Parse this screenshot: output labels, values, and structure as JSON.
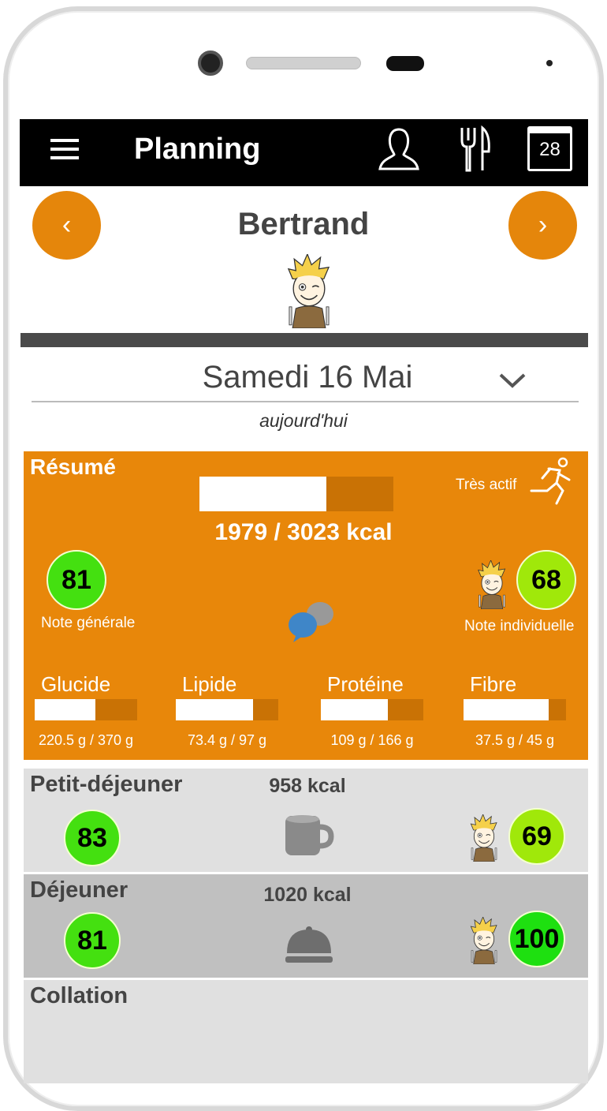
{
  "app_bar": {
    "title": "Planning",
    "icons": [
      "menu-icon",
      "user-icon",
      "fork-knife-icon",
      "calendar-icon"
    ],
    "calendar_day": "28"
  },
  "profile": {
    "name": "Bertrand",
    "prev_icon": "chevron-left",
    "next_icon": "chevron-right"
  },
  "date": {
    "label": "Samedi 16 Mai",
    "sub": "aujourd'hui"
  },
  "summary": {
    "title": "Résumé",
    "activity": "Très actif",
    "kcal_text": "1979 / 3023 kcal",
    "kcal_progress": 0.655,
    "general_score": "81",
    "general_label": "Note générale",
    "individual_score": "68",
    "individual_label": "Note individuelle",
    "macros": [
      {
        "label": "Glucide",
        "value": "220.5 g / 370 g",
        "progress": 0.596
      },
      {
        "label": "Lipide",
        "value": "73.4 g / 97 g",
        "progress": 0.757
      },
      {
        "label": "Protéine",
        "value": "109 g / 166 g",
        "progress": 0.657
      },
      {
        "label": "Fibre",
        "value": "37.5 g / 45 g",
        "progress": 0.833
      }
    ]
  },
  "meals": [
    {
      "name": "Petit-déjeuner",
      "kcal": "958 kcal",
      "score": "83",
      "individual": "69",
      "icon": "mug-icon",
      "score_color": "#44E010",
      "ind_color": "#A0E80A"
    },
    {
      "name": "Déjeuner",
      "kcal": "1020 kcal",
      "score": "81",
      "individual": "100",
      "icon": "cloche-icon",
      "score_color": "#44E010",
      "ind_color": "#1EE010"
    },
    {
      "name": "Collation"
    }
  ],
  "colors": {
    "accent": "#E8870A",
    "appbar": "#000000",
    "good": "#44E010",
    "ok": "#A0E80A"
  }
}
